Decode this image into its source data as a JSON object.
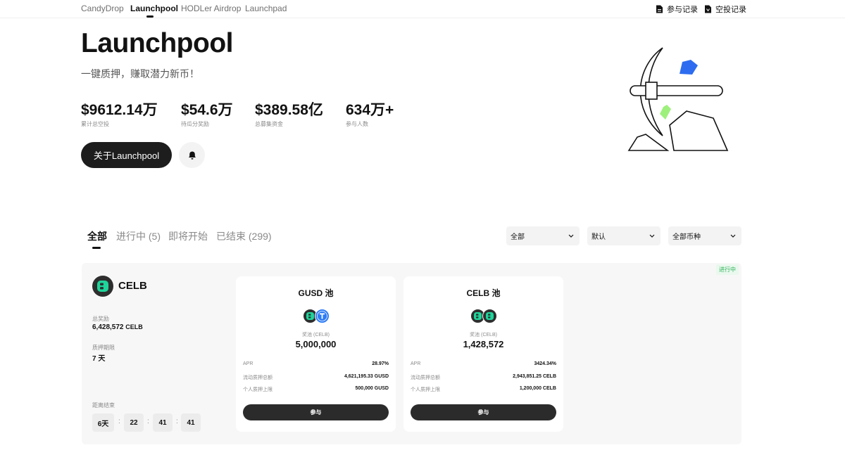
{
  "nav": {
    "tabs": [
      {
        "label": "CandyDrop"
      },
      {
        "label": "Launchpool"
      },
      {
        "label": "HODLer Airdrop"
      },
      {
        "label": "Launchpad"
      }
    ],
    "links": {
      "participation": "参与记录",
      "airdrop": "空投记录"
    }
  },
  "hero": {
    "title": "Launchpool",
    "subtitle": "一键质押，赚取潜力新币！",
    "stats": [
      {
        "value": "$9612.14万",
        "label": "累计总空投"
      },
      {
        "value": "$54.6万",
        "label": "待瓜分奖励"
      },
      {
        "value": "$389.58亿",
        "label": "总募集资金"
      },
      {
        "value": "634万+",
        "label": "参与人数"
      }
    ],
    "about_button": "关于Launchpool"
  },
  "filters": {
    "tabs": [
      "全部",
      "进行中 (5)",
      "即将开始",
      "已结束 (299)"
    ],
    "selects": [
      "全部",
      "默认",
      "全部币种"
    ]
  },
  "project": {
    "status": "进行中",
    "name": "CELB",
    "total_reward_label": "总奖励",
    "total_reward_value": "6,428,572",
    "total_reward_unit": "CELB",
    "period_label": "质押期限",
    "period_value": "7 天",
    "countdown_label": "距离结束",
    "countdown": [
      "6天",
      "22",
      "41",
      "41"
    ],
    "countdown_sep": ":",
    "pools": [
      {
        "title": "GUSD 池",
        "pool_label": "奖池 (CELB)",
        "pool_amount": "5,000,000",
        "apr_label": "APR",
        "apr": "28.97%",
        "total_label": "流动质押总额",
        "total": "4,621,195.33 GUSD",
        "cap_label": "个人质押上限",
        "cap": "500,000 GUSD",
        "join": "参与"
      },
      {
        "title": "CELB 池",
        "pool_label": "奖池 (CELB)",
        "pool_amount": "1,428,572",
        "apr_label": "APR",
        "apr": "3424.34%",
        "total_label": "流动质押总额",
        "total": "2,943,851.25 CELB",
        "cap_label": "个人质押上限",
        "cap": "1,200,000 CELB",
        "join": "参与"
      }
    ]
  },
  "colors": {
    "accent_dark": "#1d1d1d",
    "status_green": "#2fb35a",
    "celb_green": "#1ed59a",
    "gusd_blue": "#2d7cf6"
  },
  "icons": [
    "document-icon",
    "bell-icon",
    "chevron-down-icon",
    "celb-coin-icon",
    "gusd-coin-icon"
  ]
}
